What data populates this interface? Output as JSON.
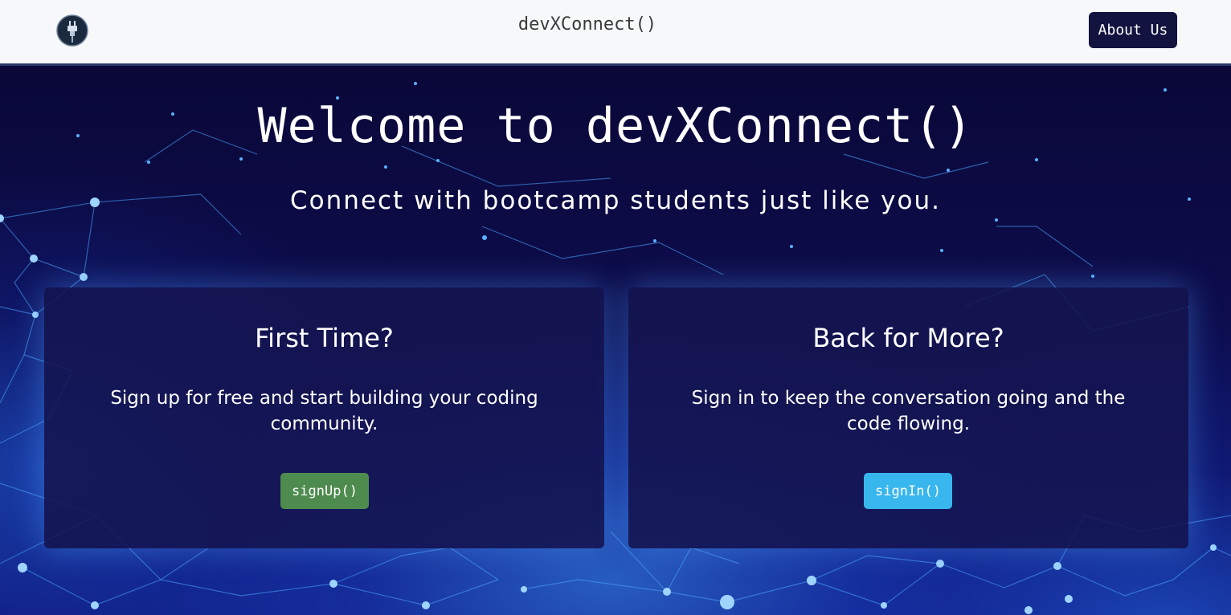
{
  "navbar": {
    "brand": "devXConnect()",
    "about_label": "About Us",
    "logo_icon": "plug-icon"
  },
  "hero": {
    "title": "Welcome to devXConnect()",
    "subtitle": "Connect with bootcamp students just like you."
  },
  "cards": [
    {
      "title": "First Time?",
      "text": "Sign up for free and start building your coding community.",
      "button_label": "signUp()",
      "button_color": "#4e8b4e"
    },
    {
      "title": "Back for More?",
      "text": "Sign in to keep the conversation going and the code flowing.",
      "button_label": "signIn()",
      "button_color": "#38b6ee"
    }
  ],
  "colors": {
    "nav_background": "#f7f8fa",
    "about_button": "#131340",
    "card_background": "#141450",
    "hero_background": "#0a0838"
  }
}
